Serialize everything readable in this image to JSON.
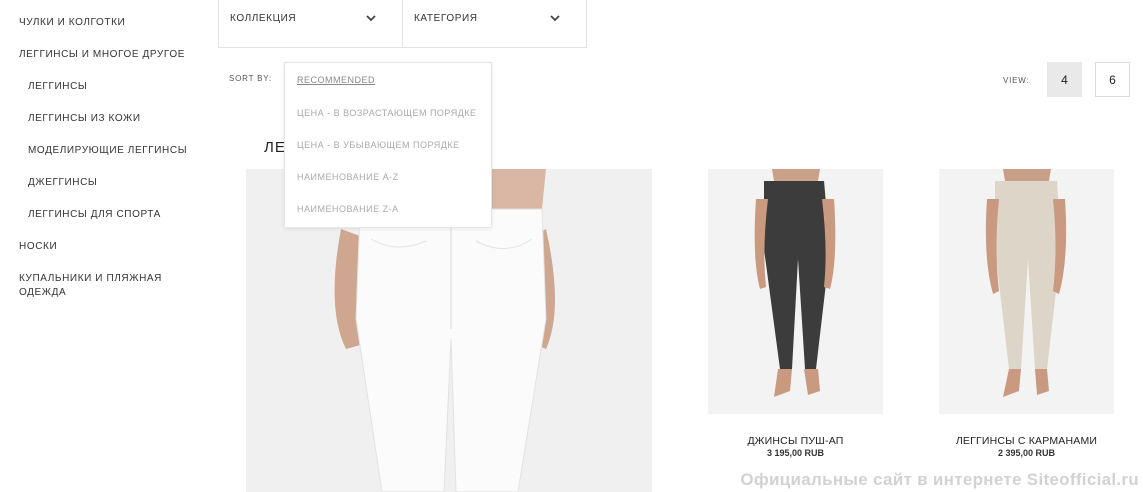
{
  "sidebar": {
    "items": [
      {
        "label": "ЧУЛКИ И КОЛГОТКИ"
      },
      {
        "label": "ЛЕГГИНСЫ И МНОГОЕ ДРУГОЕ"
      },
      {
        "label": "ЛЕГГИНСЫ"
      },
      {
        "label": "ЛЕГГИНСЫ ИЗ КОЖИ"
      },
      {
        "label": "МОДЕЛИРУЮЩИЕ ЛЕГГИНСЫ"
      },
      {
        "label": "ДЖЕГГИНСЫ"
      },
      {
        "label": "ЛЕГГИНСЫ ДЛЯ СПОРТА"
      },
      {
        "label": "НОСКИ"
      },
      {
        "label": "КУПАЛЬНИКИ И ПЛЯЖНАЯ ОДЕЖДА"
      }
    ]
  },
  "filters": {
    "collection_label": "КОЛЛЕКЦИЯ",
    "category_label": "КАТЕГОРИЯ"
  },
  "sort": {
    "label": "SORT BY:",
    "options": [
      {
        "label": "RECOMMENDED",
        "selected": true
      },
      {
        "label": "ЦЕНА - В ВОЗРАСТАЮЩЕМ ПОРЯДКЕ"
      },
      {
        "label": "ЦЕНА - В УБЫВАЮЩЕМ ПОРЯДКЕ"
      },
      {
        "label": "НАИМЕНОВАНИЕ A-Z"
      },
      {
        "label": "НАИМЕНОВАНИЕ Z-A"
      }
    ]
  },
  "view": {
    "label": "VIEW:",
    "options": [
      "4",
      "6"
    ],
    "selected": "4"
  },
  "main": {
    "heading_partial": "ЛЕ"
  },
  "products": [
    {
      "name": "ДЖИНСЫ ПУШ-АП",
      "price": "3 195,00 RUB"
    },
    {
      "name": "ЛЕГГИНСЫ С КАРМАНАМИ",
      "price": "2 395,00 RUB"
    }
  ],
  "watermark": "Официальные сайт в интернете Siteofficial.ru",
  "colors": {
    "background": "#ffffff",
    "text": "#222222",
    "muted": "#a9a9a9",
    "border": "#e3e3e3",
    "selected_view_bg": "#e9e9e9",
    "photo_bg": "#efefef"
  }
}
